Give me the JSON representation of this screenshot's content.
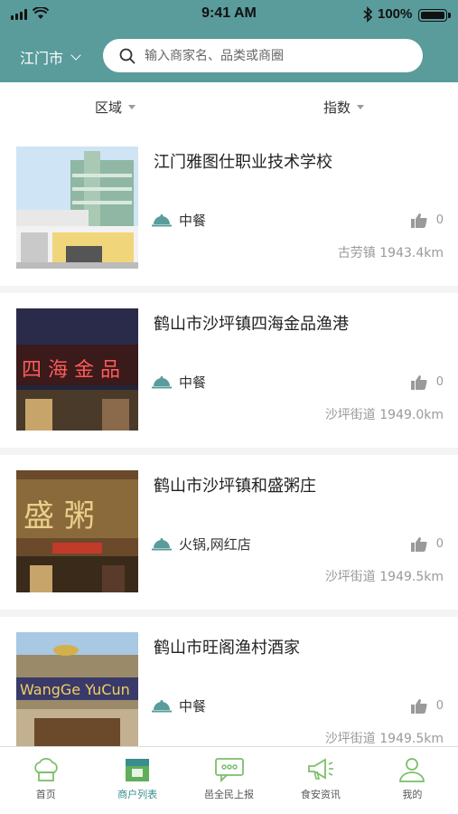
{
  "status_bar": {
    "time": "9:41 AM",
    "battery": "100%"
  },
  "header": {
    "city": "江门市",
    "search_placeholder": "输入商家名、品类或商圈"
  },
  "filters": {
    "area": "区域",
    "index": "指数"
  },
  "colors": {
    "header_bg": "#5a9b9b",
    "accent": "#3a8d8d",
    "tab_icon": "#7bbf6a"
  },
  "merchants": [
    {
      "title": "江门雅图仕职业技术学校",
      "category": "中餐",
      "likes": "0",
      "location": "古劳镇 1943.4km"
    },
    {
      "title": "鹤山市沙坪镇四海金品渔港",
      "category": "中餐",
      "likes": "0",
      "location": "沙坪街道 1949.0km"
    },
    {
      "title": "鹤山市沙坪镇和盛粥庄",
      "category": "火锅,网红店",
      "likes": "0",
      "location": "沙坪街道 1949.5km"
    },
    {
      "title": "鹤山市旺阁渔村酒家",
      "category": "中餐",
      "likes": "0",
      "location": "沙坪街道 1949.5km"
    }
  ],
  "tabs": [
    {
      "label": "首页",
      "icon": "chef-hat-icon"
    },
    {
      "label": "商户列表",
      "icon": "storefront-icon"
    },
    {
      "label": "邑全民上报",
      "icon": "chat-bubble-icon"
    },
    {
      "label": "食安资讯",
      "icon": "megaphone-icon"
    },
    {
      "label": "我的",
      "icon": "person-icon"
    }
  ],
  "active_tab": "商户列表"
}
